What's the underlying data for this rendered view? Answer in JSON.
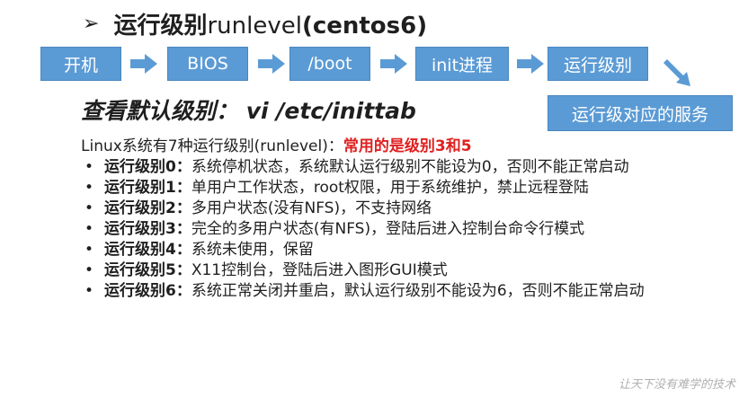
{
  "title": {
    "bold": "运行级别",
    "runlevel": "runlevel",
    "paren": "(centos6)"
  },
  "flow": [
    "开机",
    "BIOS",
    "/boot",
    "init进程",
    "运行级别"
  ],
  "services_box": "运行级对应的服务",
  "subtitle": "查看默认级别：   vi /etc/inittab",
  "intro": {
    "text": "Linux系统有7种运行级别(runlevel)：",
    "highlight": "常用的是级别3和5"
  },
  "levels": [
    {
      "label": "运行级别0：",
      "desc": "系统停机状态，系统默认运行级别不能设为0，否则不能正常启动"
    },
    {
      "label": "运行级别1：",
      "desc": "单用户工作状态，root权限，用于系统维护，禁止远程登陆"
    },
    {
      "label": "运行级别2：",
      "desc": "多用户状态(没有NFS)，不支持网络"
    },
    {
      "label": "运行级别3：",
      "desc": "完全的多用户状态(有NFS)，登陆后进入控制台命令行模式"
    },
    {
      "label": "运行级别4：",
      "desc": "系统未使用，保留"
    },
    {
      "label": "运行级别5：",
      "desc": "X11控制台，登陆后进入图形GUI模式"
    },
    {
      "label": "运行级别6：",
      "desc": "系统正常关闭并重启，默认运行级别不能设为6，否则不能正常启动"
    }
  ],
  "watermark": "让天下没有难学的技术",
  "colors": {
    "box": "#5b9bd5",
    "highlight": "#e02020"
  }
}
